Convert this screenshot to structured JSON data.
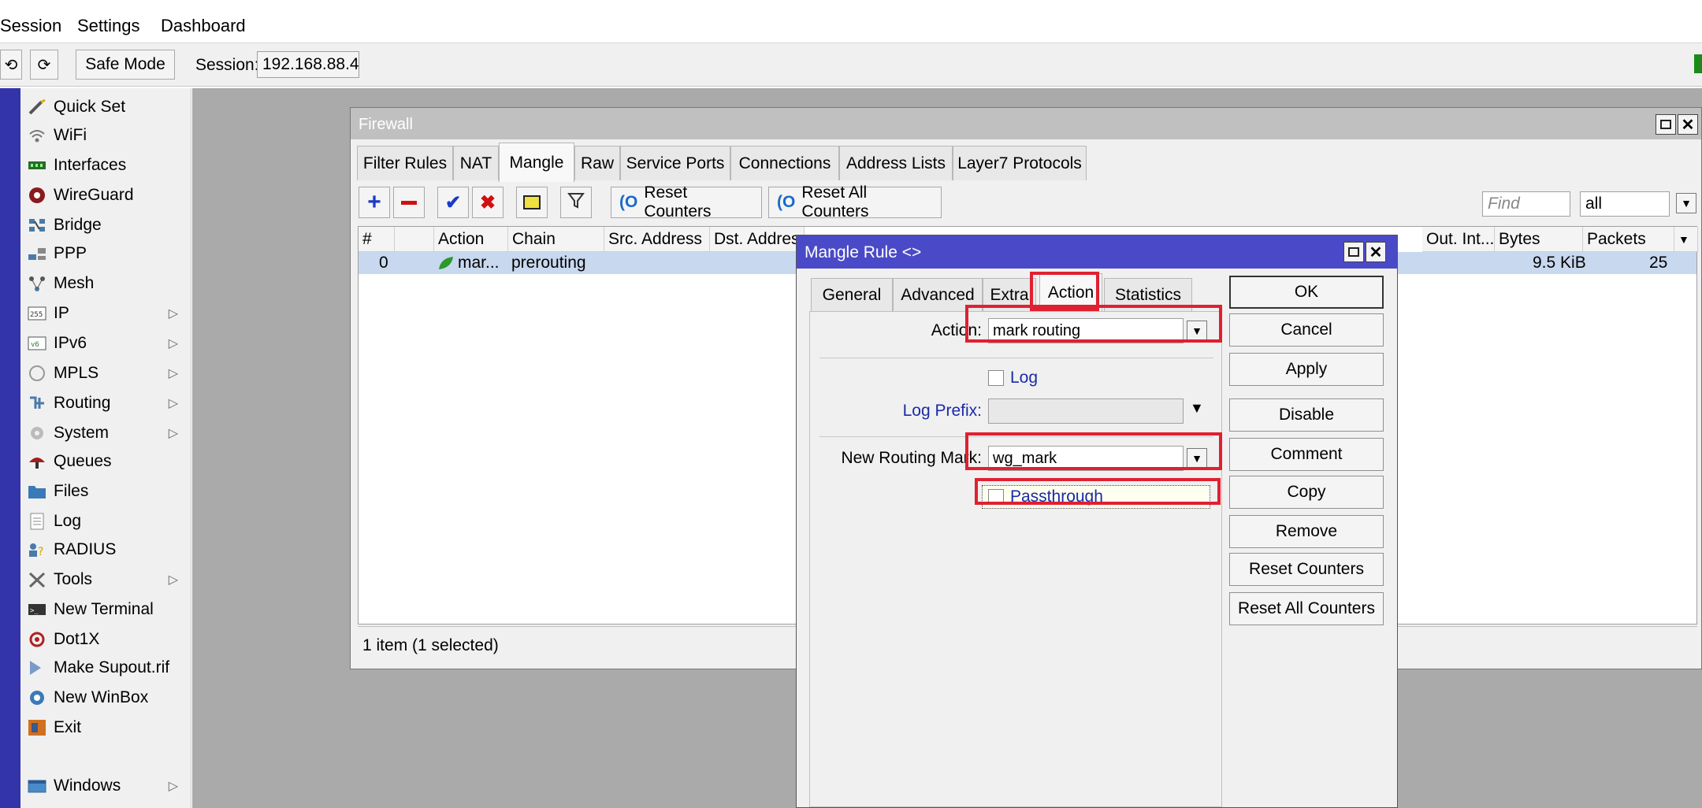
{
  "menubar": {
    "items": [
      "Session",
      "Settings",
      "Dashboard"
    ]
  },
  "toolbar": {
    "undo_icon": "undo-icon",
    "redo_icon": "redo-icon",
    "safe_mode_label": "Safe Mode",
    "session_label": "Session:",
    "session_value": "192.168.88.4"
  },
  "sidebar": {
    "items": [
      {
        "label": "Quick Set",
        "icon": "wand-icon",
        "submenu": false
      },
      {
        "label": "WiFi",
        "icon": "wifi-icon",
        "submenu": false
      },
      {
        "label": "Interfaces",
        "icon": "interfaces-icon",
        "submenu": false
      },
      {
        "label": "WireGuard",
        "icon": "wireguard-icon",
        "submenu": false
      },
      {
        "label": "Bridge",
        "icon": "bridge-icon",
        "submenu": false
      },
      {
        "label": "PPP",
        "icon": "ppp-icon",
        "submenu": false
      },
      {
        "label": "Mesh",
        "icon": "mesh-icon",
        "submenu": false
      },
      {
        "label": "IP",
        "icon": "ip-icon",
        "submenu": true
      },
      {
        "label": "IPv6",
        "icon": "ipv6-icon",
        "submenu": true
      },
      {
        "label": "MPLS",
        "icon": "mpls-icon",
        "submenu": true
      },
      {
        "label": "Routing",
        "icon": "routing-icon",
        "submenu": true
      },
      {
        "label": "System",
        "icon": "gear-icon",
        "submenu": true
      },
      {
        "label": "Queues",
        "icon": "queues-icon",
        "submenu": false
      },
      {
        "label": "Files",
        "icon": "folder-icon",
        "submenu": false
      },
      {
        "label": "Log",
        "icon": "log-icon",
        "submenu": false
      },
      {
        "label": "RADIUS",
        "icon": "radius-icon",
        "submenu": false
      },
      {
        "label": "Tools",
        "icon": "tools-icon",
        "submenu": true
      },
      {
        "label": "New Terminal",
        "icon": "terminal-icon",
        "submenu": false
      },
      {
        "label": "Dot1X",
        "icon": "dot1x-icon",
        "submenu": false
      },
      {
        "label": "Make Supout.rif",
        "icon": "supout-icon",
        "submenu": false
      },
      {
        "label": "New WinBox",
        "icon": "winbox-icon",
        "submenu": false
      },
      {
        "label": "Exit",
        "icon": "exit-icon",
        "submenu": false
      }
    ],
    "windows_label": "Windows"
  },
  "firewall": {
    "title": "Firewall",
    "tabs": [
      "Filter Rules",
      "NAT",
      "Mangle",
      "Raw",
      "Service Ports",
      "Connections",
      "Address Lists",
      "Layer7 Protocols"
    ],
    "active_tab": "Mangle",
    "toolbar": {
      "reset_counters": "Reset Counters",
      "reset_all_counters": "Reset All Counters",
      "find_placeholder": "Find",
      "filter_value": "all"
    },
    "columns": [
      "#",
      "",
      "Action",
      "Chain",
      "Src. Address",
      "Dst. Address",
      "Out. Int...",
      "Bytes",
      "Packets",
      "Out. Int..."
    ],
    "row": {
      "num": "0",
      "action": "mar...",
      "chain": "prerouting",
      "bytes": "9.5 KiB",
      "packets": "25"
    },
    "status": "1 item (1 selected)"
  },
  "mangle": {
    "title": "Mangle Rule <>",
    "tabs": [
      "General",
      "Advanced",
      "Extra",
      "Action",
      "Statistics"
    ],
    "active_tab": "Action",
    "action_label": "Action:",
    "action_value": "mark routing",
    "log_label": "Log",
    "log_prefix_label": "Log Prefix:",
    "routing_mark_label": "New Routing Mark:",
    "routing_mark_value": "wg_mark",
    "passthrough_label": "Passthrough",
    "buttons": [
      "OK",
      "Cancel",
      "Apply",
      "Disable",
      "Comment",
      "Copy",
      "Remove",
      "Reset Counters",
      "Reset All Counters"
    ]
  }
}
